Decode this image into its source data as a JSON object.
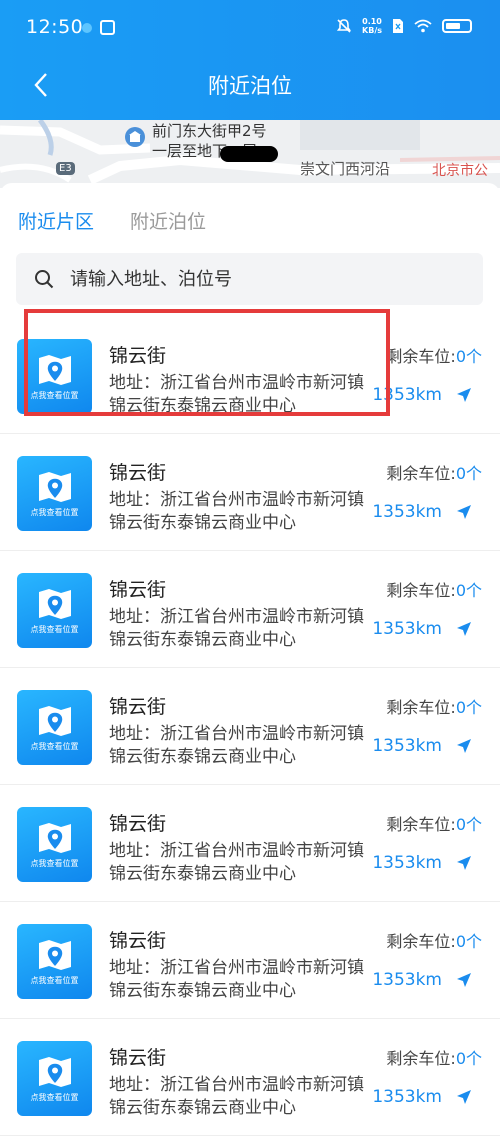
{
  "status_bar": {
    "time": "12:50",
    "net_speed_value": "0.10",
    "net_speed_unit": "KB/s"
  },
  "nav": {
    "title": "附近泊位"
  },
  "map": {
    "label_line1": "前门东大街甲2号",
    "label_line2": "一层至地下一层",
    "road_name": "崇文门西河沿",
    "place_label": "北京市公",
    "route_badge": "E3"
  },
  "tabs": [
    {
      "label": "附近片区",
      "active": true
    },
    {
      "label": "附近泊位",
      "active": false
    }
  ],
  "search": {
    "placeholder": "请输入地址、泊位号"
  },
  "list": {
    "items": [
      {
        "thumb_caption": "点我查看位置",
        "name": "锦云街",
        "remain_label": "剩余车位:",
        "remain_count": "0个",
        "address": "地址：浙江省台州市温岭市新河镇锦云街东泰锦云商业中心",
        "distance": "1353km"
      },
      {
        "thumb_caption": "点我查看位置",
        "name": "锦云街",
        "remain_label": "剩余车位:",
        "remain_count": "0个",
        "address": "地址：浙江省台州市温岭市新河镇锦云街东泰锦云商业中心",
        "distance": "1353km"
      },
      {
        "thumb_caption": "点我查看位置",
        "name": "锦云街",
        "remain_label": "剩余车位:",
        "remain_count": "0个",
        "address": "地址：浙江省台州市温岭市新河镇锦云街东泰锦云商业中心",
        "distance": "1353km"
      },
      {
        "thumb_caption": "点我查看位置",
        "name": "锦云街",
        "remain_label": "剩余车位:",
        "remain_count": "0个",
        "address": "地址：浙江省台州市温岭市新河镇锦云街东泰锦云商业中心",
        "distance": "1353km"
      },
      {
        "thumb_caption": "点我查看位置",
        "name": "锦云街",
        "remain_label": "剩余车位:",
        "remain_count": "0个",
        "address": "地址：浙江省台州市温岭市新河镇锦云街东泰锦云商业中心",
        "distance": "1353km"
      },
      {
        "thumb_caption": "点我查看位置",
        "name": "锦云街",
        "remain_label": "剩余车位:",
        "remain_count": "0个",
        "address": "地址：浙江省台州市温岭市新河镇锦云街东泰锦云商业中心",
        "distance": "1353km"
      },
      {
        "thumb_caption": "点我查看位置",
        "name": "锦云街",
        "remain_label": "剩余车位:",
        "remain_count": "0个",
        "address": "地址：浙江省台州市温岭市新河镇锦云街东泰锦云商业中心",
        "distance": "1353km"
      }
    ]
  },
  "colors": {
    "header_blue": "#1a9df5",
    "accent_blue": "#1a8cee",
    "highlight_red": "#e53b3b"
  },
  "icons": [
    "back-arrow-icon",
    "search-icon",
    "map-pin-icon",
    "navigate-arrow-icon",
    "wifi-icon",
    "battery-icon"
  ]
}
